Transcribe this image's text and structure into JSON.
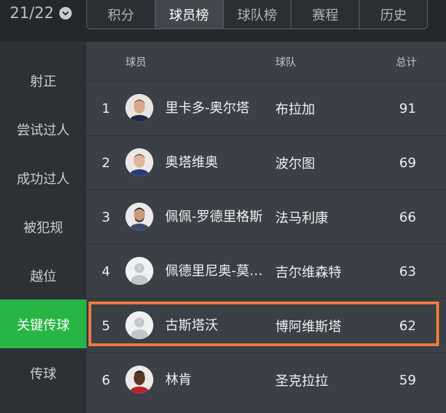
{
  "season": {
    "label": "21/22"
  },
  "tabs": [
    "积分",
    "球员榜",
    "球队榜",
    "赛程",
    "历史"
  ],
  "active_tab": "球员榜",
  "sidebar": {
    "items": [
      "射正",
      "尝试过人",
      "成功过人",
      "被犯规",
      "越位",
      "关键传球",
      "传球"
    ],
    "active": "关键传球"
  },
  "table": {
    "headers": {
      "player": "球员",
      "team": "球队",
      "total": "总计"
    },
    "rows": [
      {
        "rank": "1",
        "player": "里卡多-奥尔塔",
        "team": "布拉加",
        "total": "91",
        "avatar": "photo"
      },
      {
        "rank": "2",
        "player": "奥塔维奥",
        "team": "波尔图",
        "total": "69",
        "avatar": "photo"
      },
      {
        "rank": "3",
        "player": "佩佩-罗德里格斯",
        "team": "法马利康",
        "total": "66",
        "avatar": "photo"
      },
      {
        "rank": "4",
        "player": "佩德里尼奥-莫…",
        "team": "吉尔维森特",
        "total": "63",
        "avatar": "placeholder"
      },
      {
        "rank": "5",
        "player": "古斯塔沃",
        "team": "博阿维斯塔",
        "total": "62",
        "avatar": "placeholder"
      },
      {
        "rank": "6",
        "player": "林肯",
        "team": "圣克拉拉",
        "total": "59",
        "avatar": "photo"
      }
    ],
    "highlighted_rank": "5"
  },
  "colors": {
    "accent_green": "#27b546",
    "highlight_orange": "#f07a3e",
    "background": "#3a4045",
    "sidebar": "#2c3135"
  }
}
